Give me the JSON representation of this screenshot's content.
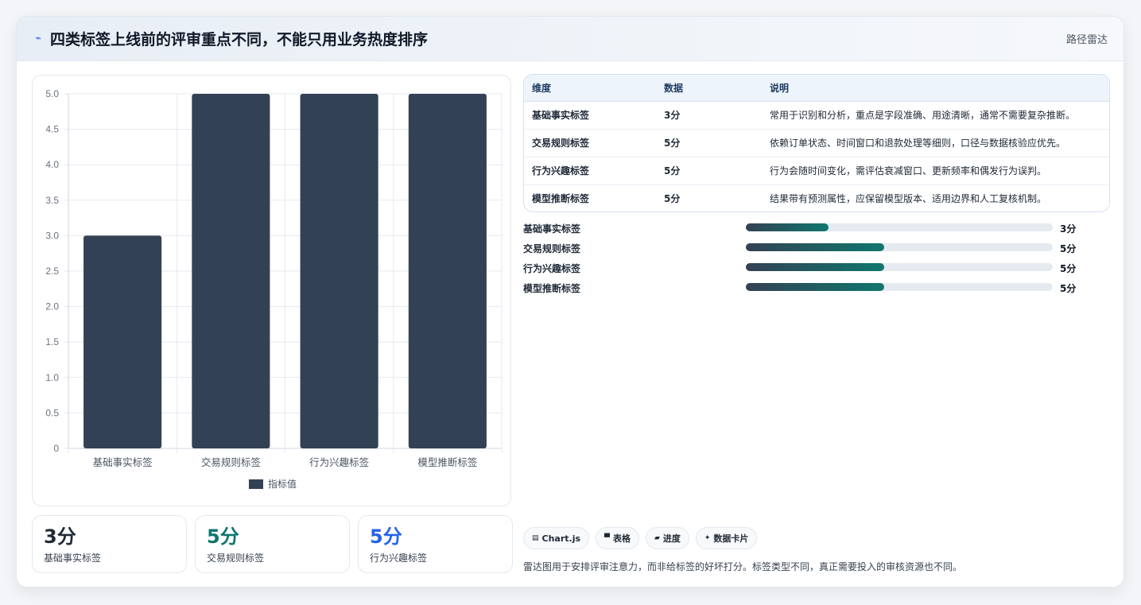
{
  "header": {
    "title": "四类标签上线前的评审重点不同，不能只用业务热度排序",
    "link": "路径雷达",
    "logo_icon": "spark-icon"
  },
  "chart_data": {
    "type": "bar",
    "categories": [
      "基础事实标签",
      "交易规则标签",
      "行为兴趣标签",
      "模型推断标签"
    ],
    "series": [
      {
        "name": "指标值",
        "values": [
          3,
          5,
          5,
          5
        ],
        "color": "#334155"
      }
    ],
    "ylim": [
      0,
      5
    ],
    "yticks": [
      "0",
      "0.5",
      "1.0",
      "1.5",
      "2.0",
      "2.5",
      "3.0",
      "3.5",
      "4.0",
      "4.5",
      "5.0"
    ],
    "legend": "bottom",
    "grid": true
  },
  "table": {
    "headers": [
      "维度",
      "数据",
      "说明"
    ],
    "rows": [
      [
        "基础事实标签",
        "3分",
        "常用于识别和分析，重点是字段准确、用途清晰，通常不需要复杂推断。"
      ],
      [
        "交易规则标签",
        "5分",
        "依赖订单状态、时间窗口和退款处理等细则，口径与数据核验应优先。"
      ],
      [
        "行为兴趣标签",
        "5分",
        "行为会随时间变化，需评估衰减窗口、更新频率和偶发行为误判。"
      ],
      [
        "模型推断标签",
        "5分",
        "结果带有预测属性，应保留模型版本、适用边界和人工复核机制。"
      ]
    ]
  },
  "progress": [
    {
      "label": "基础事实标签",
      "value": "3分",
      "fraction": 0.27
    },
    {
      "label": "交易规则标签",
      "value": "5分",
      "fraction": 0.45
    },
    {
      "label": "行为兴趣标签",
      "value": "5分",
      "fraction": 0.45
    },
    {
      "label": "模型推断标签",
      "value": "5分",
      "fraction": 0.45
    }
  ],
  "stats": [
    {
      "value": "3分",
      "label": "基础事实标签",
      "color": "#1f2937"
    },
    {
      "value": "5分",
      "label": "交易规则标签",
      "color": "#0f766e"
    },
    {
      "value": "5分",
      "label": "行为兴趣标签",
      "color": "#2563eb"
    }
  ],
  "chips": [
    {
      "icon": "▤",
      "label": "Chart.js"
    },
    {
      "icon": "▀",
      "label": "表格"
    },
    {
      "icon": "▰",
      "label": "进度"
    },
    {
      "icon": "✦",
      "label": "数据卡片"
    }
  ],
  "note": "雷达图用于安排评审注意力，而非给标签的好坏打分。标签类型不同，真正需要投入的审核资源也不同。"
}
